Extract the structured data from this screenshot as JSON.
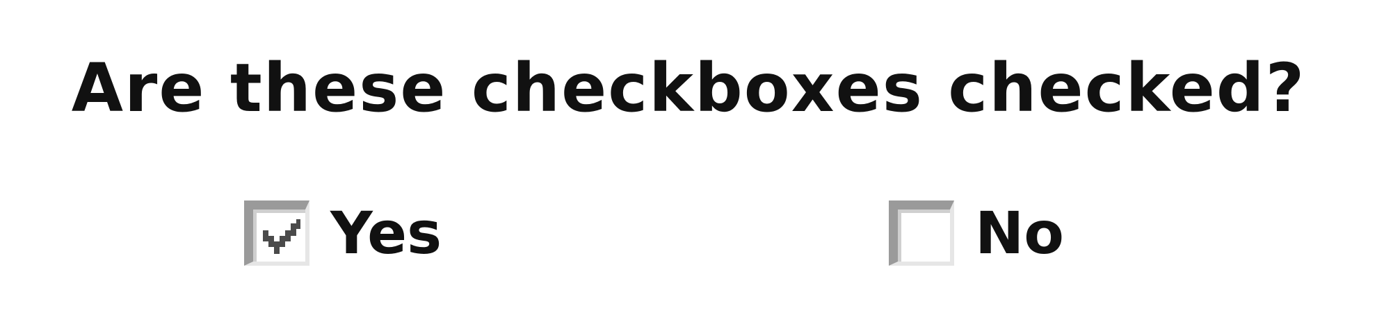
{
  "question": {
    "title": "Are these checkboxes checked?"
  },
  "options": [
    {
      "label": "Yes",
      "checked": true
    },
    {
      "label": "No",
      "checked": false
    }
  ],
  "colors": {
    "text": "#111111",
    "checkbox_border_dark": "#9a9a9a",
    "checkbox_border_light": "#e6e6e6",
    "checkmark": "#4a4a4a",
    "background": "#ffffff"
  }
}
